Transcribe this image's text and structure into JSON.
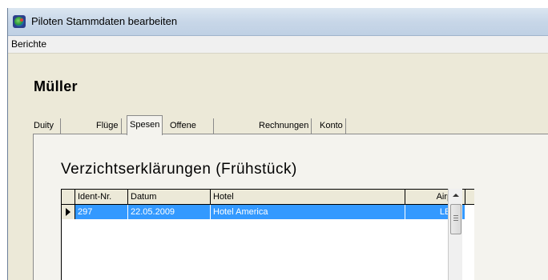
{
  "window": {
    "title": "Piloten Stammdaten bearbeiten",
    "app_icon": "globe-icon"
  },
  "menubar": {
    "items": [
      "Berichte"
    ]
  },
  "person": {
    "name": "Müller"
  },
  "tabs": [
    {
      "label": "Duity Times",
      "active": false
    },
    {
      "label": "Flüge",
      "active": false
    },
    {
      "label": "Spesen",
      "active": true
    },
    {
      "label": "Offene Positionen",
      "active": false
    },
    {
      "label": "Rechnungen",
      "active": false
    },
    {
      "label": "Konto",
      "active": false
    }
  ],
  "section": {
    "title": "Verzichtserklärungen (Frühstück)"
  },
  "grid": {
    "columns": [
      "Ident-Nr.",
      "Datum",
      "Hotel",
      "Airport"
    ],
    "rows": [
      {
        "ident": "297",
        "datum": "22.05.2009",
        "hotel": "Hotel America",
        "airport": "LEVX",
        "selected": true
      }
    ]
  },
  "colors": {
    "selection": "#3399ff",
    "panel": "#f4f3ee"
  }
}
